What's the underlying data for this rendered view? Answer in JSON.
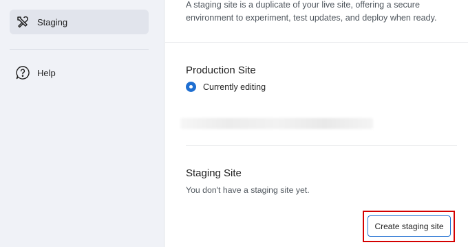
{
  "sidebar": {
    "items": [
      {
        "label": "Staging",
        "icon": "tools-icon",
        "active": true
      },
      {
        "label": "Help",
        "icon": "help-chat-icon",
        "active": false
      }
    ]
  },
  "main": {
    "intro": "A staging site is a duplicate of your live site, offering a secure environment to experiment, test updates, and deploy when ready.",
    "production": {
      "title": "Production Site",
      "radio_label": "Currently editing"
    },
    "staging": {
      "title": "Staging Site",
      "description": "You don't have a staging site yet.",
      "button_label": "Create staging site"
    }
  },
  "colors": {
    "accent": "#1f6fd1",
    "highlight": "#d40000",
    "sidebar_bg": "#f0f2f7"
  }
}
